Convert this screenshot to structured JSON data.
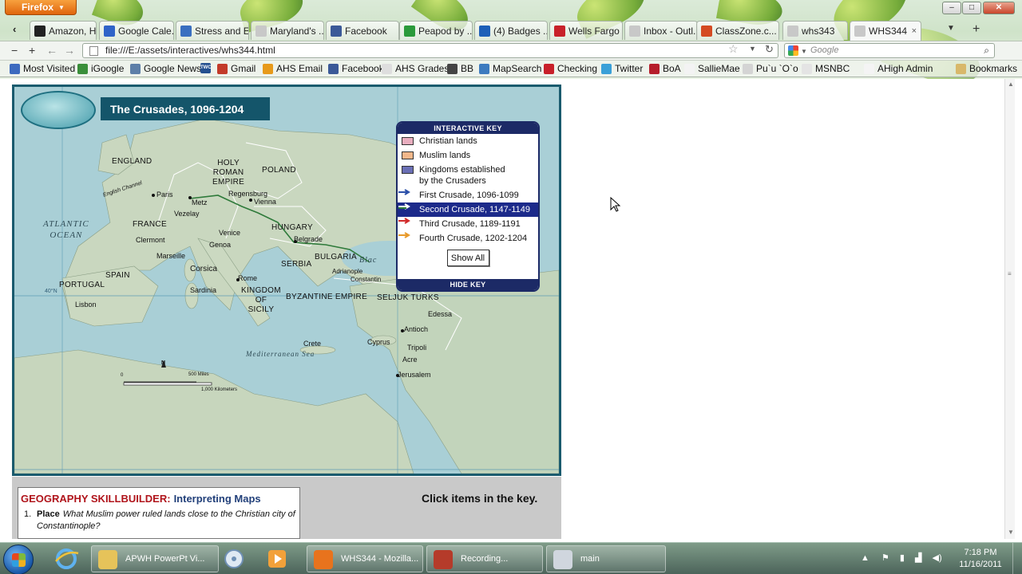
{
  "browser": {
    "menu_button": "Firefox",
    "tabs": [
      {
        "label": "Amazon, H...",
        "icon_color": "#222222",
        "icon_glyph": "a"
      },
      {
        "label": "Google Cale...",
        "icon_color": "#2f63c8",
        "icon_glyph": "16"
      },
      {
        "label": "Stress and E...",
        "icon_color": "#3a6fc0",
        "icon_glyph": ""
      },
      {
        "label": "Maryland's ...",
        "icon_color": "#c8c8c8",
        "icon_glyph": ""
      },
      {
        "label": "Facebook",
        "icon_color": "#3b5998",
        "icon_glyph": "f"
      },
      {
        "label": "Peapod by ...",
        "icon_color": "#2a9a3a",
        "icon_glyph": ""
      },
      {
        "label": "(4) Badges ...",
        "icon_color": "#1d5fb8",
        "icon_glyph": ""
      },
      {
        "label": "Wells Fargo ...",
        "icon_color": "#c8202a",
        "icon_glyph": "WF"
      },
      {
        "label": "Inbox - Outl...",
        "icon_color": "#c8c8c8",
        "icon_glyph": ""
      },
      {
        "label": "ClassZone.c...",
        "icon_color": "#d44a22",
        "icon_glyph": ""
      },
      {
        "label": "whs343",
        "icon_color": "#c8c8c8",
        "icon_glyph": ""
      },
      {
        "label": "WHS344",
        "icon_color": "#c8c8c8",
        "icon_glyph": "",
        "active": true
      }
    ],
    "active_tab_close": "×",
    "new_tab": "+",
    "url": "file:///E:/assets/interactives/whs344.html",
    "search_engine": "Google",
    "bookmarks": [
      {
        "label": "Most Visited",
        "icon_color": "#3d6bbf"
      },
      {
        "label": "iGoogle",
        "icon_color": "#3a8f3a"
      },
      {
        "label": "Google News",
        "icon_color": "#5d7fa8"
      },
      {
        "label": "",
        "icon_color": "#24508f",
        "glyph": "TWC"
      },
      {
        "label": "Gmail",
        "icon_color": "#c33b2a"
      },
      {
        "label": "AHS Email",
        "icon_color": "#e79a1a"
      },
      {
        "label": "Facebook",
        "icon_color": "#3b5998"
      },
      {
        "label": "AHS Grades",
        "icon_color": "#dedede"
      },
      {
        "label": "BB",
        "icon_color": "#444444"
      },
      {
        "label": "MapSearch",
        "icon_color": "#3d7bbf"
      },
      {
        "label": "Checking",
        "icon_color": "#c8202a"
      },
      {
        "label": "Twitter",
        "icon_color": "#3aa0d8"
      },
      {
        "label": "BoA",
        "icon_color": "#b61e2b"
      },
      {
        "label": "SallieMae",
        "icon_color": "#f3f3f3"
      },
      {
        "label": "Pu`u `O`o",
        "icon_color": "#d4d4d4"
      },
      {
        "label": "MSNBC",
        "icon_color": "#e4e4e4"
      },
      {
        "label": "AHigh Admin",
        "icon_color": "#f4f4f4"
      },
      {
        "label": "Bookmarks",
        "icon_color": "#d8b86a"
      }
    ]
  },
  "map": {
    "title": "The Crusades, 1096-1204",
    "labels": {
      "england": "ENGLAND",
      "holy_roman_empire": "HOLY\nROMAN\nEMPIRE",
      "poland": "POLAND",
      "english_channel": "English Channel",
      "paris": "Paris",
      "metz": "Metz",
      "regensburg": "Regensburg",
      "vienna": "Vienna",
      "vezelay": "Vezelay",
      "france": "FRANCE",
      "hungary": "HUNGARY",
      "atlantic": "ATLANTIC\nOCEAN",
      "clermont": "Clermont",
      "venice": "Venice",
      "belgrade": "Belgrade",
      "genoa": "Genoa",
      "marseille": "Marseille",
      "serbia": "SERBIA",
      "bulgaria": "BULGARIA",
      "spain": "SPAIN",
      "corsica": "Corsica",
      "portugal": "PORTUGAL",
      "rome": "Rome",
      "adrianople": "Adrianople",
      "constantinople": "Constantin",
      "sardinia": "Sardinia",
      "kingdom_sicily": "KINGDOM\nOF\nSICILY",
      "byzantine": "BYZANTINE EMPIRE",
      "seljuk": "SELJUK TURKS",
      "lisbon": "Lisbon",
      "black_sea": "Blac",
      "edessa": "Edessa",
      "antioch": "Antioch",
      "crete": "Crete",
      "cyprus": "Cyprus",
      "tripoli": "Tripoli",
      "acre": "Acre",
      "jerusalem": "Jerusalem",
      "mediterranean": "Mediterranean Sea",
      "lat40": "40°N",
      "scale_miles": "500 Miles",
      "scale_km": "1,000 Kilometers",
      "scale_zero": "0",
      "north": "N"
    },
    "key": {
      "header": "INTERACTIVE KEY",
      "footer": "HIDE KEY",
      "items": [
        {
          "label": "Christian lands",
          "color": "#e9aebf",
          "kind": "swatch"
        },
        {
          "label": "Muslim lands",
          "color": "#f2b78a",
          "kind": "swatch"
        },
        {
          "label": "Kingdoms established\nby the Crusaders",
          "color": "#6a6fb5",
          "kind": "swatch"
        },
        {
          "label": "First Crusade, 1096-1099",
          "color": "#2b4fa8",
          "kind": "arrow"
        },
        {
          "label": "Second Crusade, 1147-1149",
          "color": "#2e7a3a",
          "kind": "arrow",
          "selected": true
        },
        {
          "label": "Third Crusade, 1189-1191",
          "color": "#d12a2a",
          "kind": "arrow"
        },
        {
          "label": "Fourth Crusade, 1202-1204",
          "color": "#e89a2a",
          "kind": "arrow"
        }
      ],
      "show_all": "Show All"
    }
  },
  "skillbuilder": {
    "title_red": "GEOGRAPHY SKILLBUILDER:",
    "title_blue": "Interpreting Maps",
    "q_num": "1.",
    "q_lead": "Place",
    "q_text": "What Muslim power ruled lands close to the Christian city of Constantinople?",
    "hint": "Click items in the key."
  },
  "taskbar": {
    "windows": [
      {
        "label": "APWH PowerPt Vi...",
        "icon_color": "#e6c35a"
      },
      {
        "label": "WHS344 - Mozilla...",
        "icon_color": "#e8731d"
      },
      {
        "label": "Recording...",
        "icon_color": "#b53b2a"
      },
      {
        "label": "main",
        "icon_color": "#d0d6de"
      }
    ],
    "time": "7:18 PM",
    "date": "11/16/2011"
  }
}
